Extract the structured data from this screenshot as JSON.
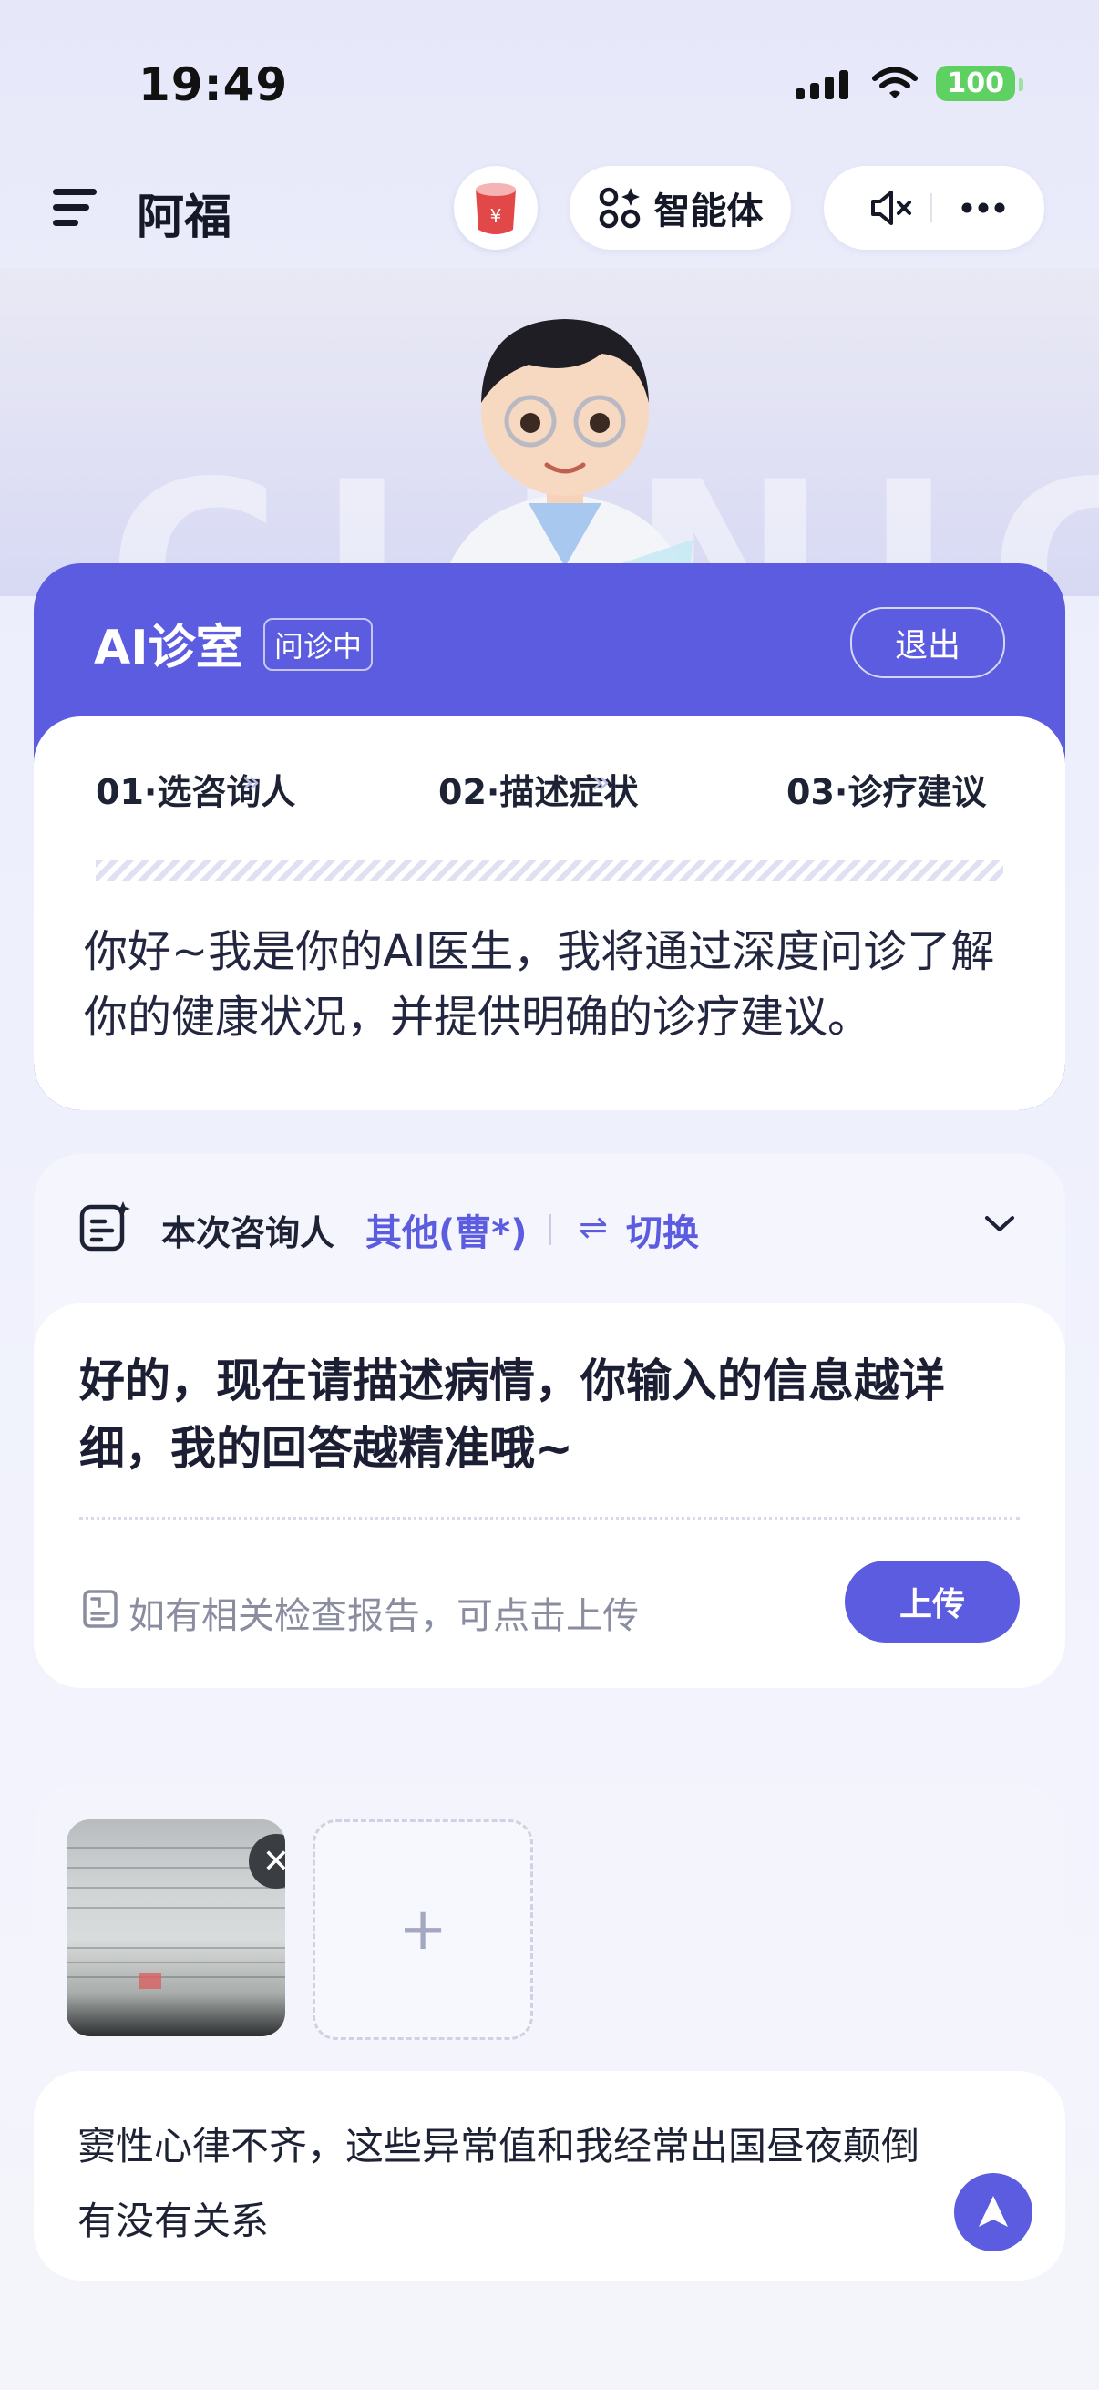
{
  "status_bar": {
    "time": "19:49",
    "battery": "100"
  },
  "header": {
    "title": "阿福",
    "agent_label": "智能体",
    "icons": [
      "menu-icon",
      "cup-avatar-icon",
      "agent-grid-icon",
      "mute-icon",
      "more-icon"
    ]
  },
  "hero": {
    "bg_word": "CLINIC"
  },
  "clinic": {
    "title": "AI诊室",
    "badge": "问诊中",
    "exit_label": "退出",
    "steps": [
      "01·选咨询人",
      "02·描述症状",
      "03·诊疗建议"
    ],
    "step_arrow": "»",
    "intro": "你好~我是你的AI医生，我将通过深度问诊了解你的健康状况，并提供明确的诊疗建议。"
  },
  "consult": {
    "label": "本次咨询人",
    "person": "其他(曹*)",
    "switch_icon": "⇌",
    "switch_label": "切换",
    "message": "好的，现在请描述病情，你输入的信息越详细，我的回答越精准哦~",
    "report_hint": "如有相关检查报告，可点击上传",
    "upload_label": "上传"
  },
  "composer": {
    "close_glyph": "✕",
    "add_glyph": "+",
    "input_value": "窦性心律不齐，这些异常值和我经常出国昼夜颠倒有没有关系"
  },
  "colors": {
    "accent": "#5b5ce0",
    "battery": "#5fd163"
  }
}
